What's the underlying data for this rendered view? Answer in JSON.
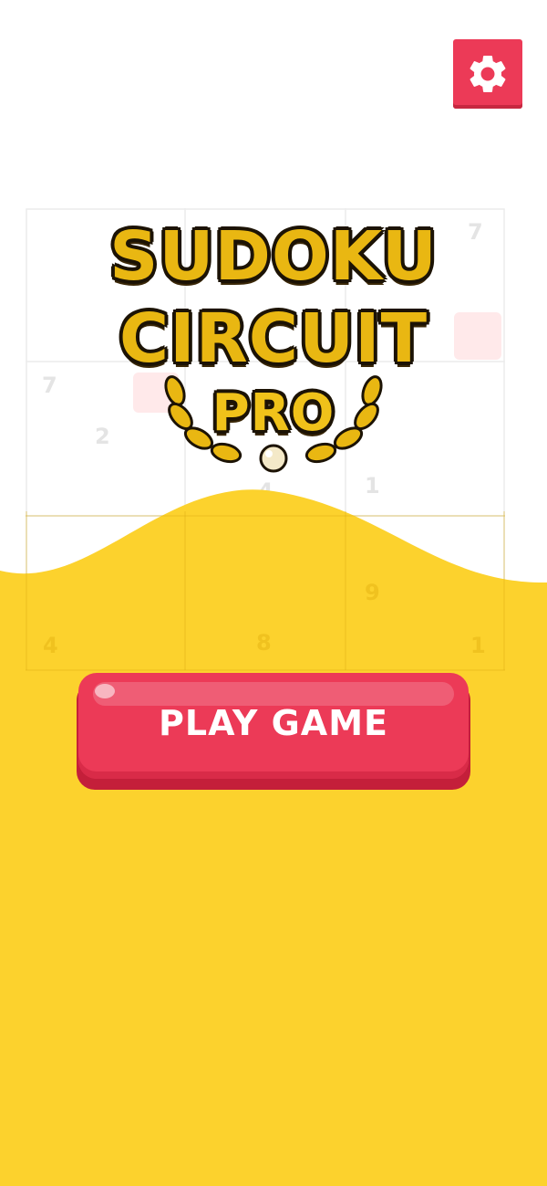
{
  "app": {
    "title_line1": "SUDOKU",
    "title_line2": "CIRCUIT",
    "title_line3": "PRO"
  },
  "header": {
    "settings_icon": "gear-icon"
  },
  "main": {
    "play_label": "PLAY GAME"
  },
  "background_grid": {
    "digits": [
      {
        "value": "7"
      },
      {
        "value": "7"
      },
      {
        "value": "2"
      },
      {
        "value": "4"
      },
      {
        "value": "1"
      },
      {
        "value": "9"
      },
      {
        "value": "4"
      },
      {
        "value": "8"
      },
      {
        "value": "1"
      }
    ]
  },
  "colors": {
    "accent": "#ec3a57",
    "background_yellow": "#fcd22d",
    "logo_gold": "#e9b712",
    "white": "#ffffff"
  }
}
